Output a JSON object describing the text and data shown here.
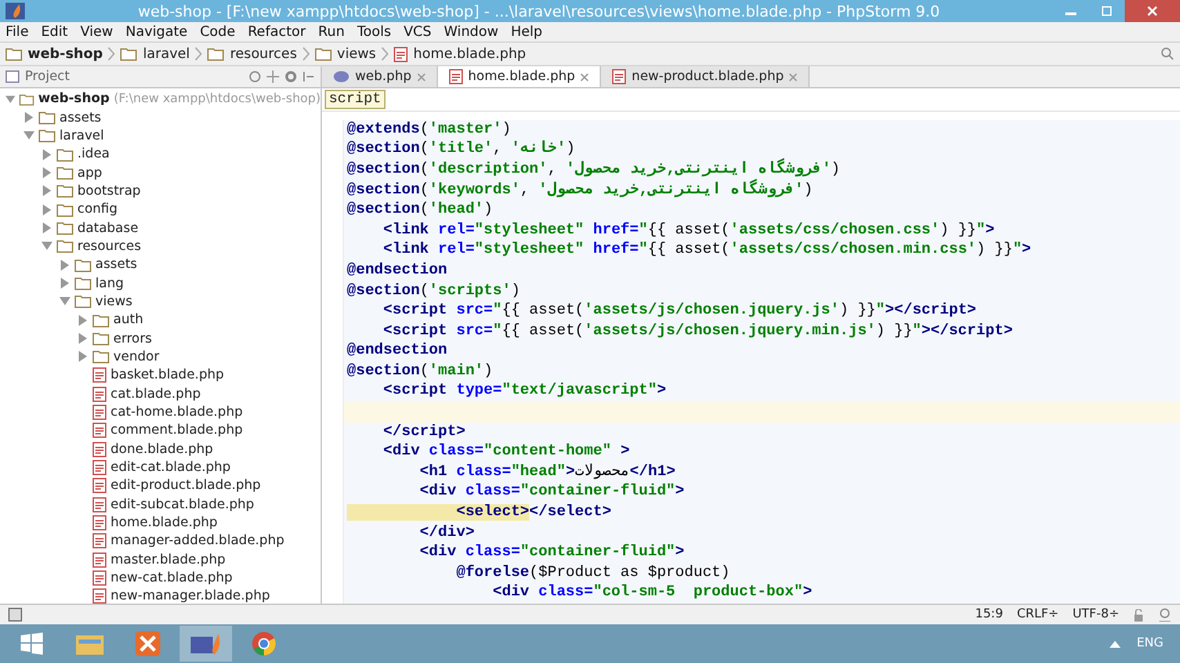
{
  "window": {
    "title": "web-shop - [F:\\new xampp\\htdocs\\web-shop] - ...\\laravel\\resources\\views\\home.blade.php - PhpStorm 9.0"
  },
  "menu": [
    "File",
    "Edit",
    "View",
    "Navigate",
    "Code",
    "Refactor",
    "Run",
    "Tools",
    "VCS",
    "Window",
    "Help"
  ],
  "breadcrumbs": [
    {
      "label": "web-shop",
      "kind": "folder"
    },
    {
      "label": "laravel",
      "kind": "folder"
    },
    {
      "label": "resources",
      "kind": "folder"
    },
    {
      "label": "views",
      "kind": "folder"
    },
    {
      "label": "home.blade.php",
      "kind": "file"
    }
  ],
  "project_panel": {
    "title": "Project",
    "tree": [
      {
        "label": "web-shop",
        "path": "(F:\\new xampp\\htdocs\\web-shop)",
        "kind": "folder",
        "expanded": true,
        "children": [
          {
            "label": "assets",
            "kind": "folder",
            "expanded": false
          },
          {
            "label": "laravel",
            "kind": "folder",
            "expanded": true,
            "children": [
              {
                "label": ".idea",
                "kind": "folder",
                "expanded": false
              },
              {
                "label": "app",
                "kind": "folder",
                "expanded": false
              },
              {
                "label": "bootstrap",
                "kind": "folder",
                "expanded": false
              },
              {
                "label": "config",
                "kind": "folder",
                "expanded": false
              },
              {
                "label": "database",
                "kind": "folder",
                "expanded": false
              },
              {
                "label": "resources",
                "kind": "folder",
                "expanded": true,
                "children": [
                  {
                    "label": "assets",
                    "kind": "folder",
                    "expanded": false
                  },
                  {
                    "label": "lang",
                    "kind": "folder",
                    "expanded": false
                  },
                  {
                    "label": "views",
                    "kind": "folder",
                    "expanded": true,
                    "children": [
                      {
                        "label": "auth",
                        "kind": "folder",
                        "expanded": false
                      },
                      {
                        "label": "errors",
                        "kind": "folder",
                        "expanded": false
                      },
                      {
                        "label": "vendor",
                        "kind": "folder",
                        "expanded": false
                      },
                      {
                        "label": "basket.blade.php",
                        "kind": "file"
                      },
                      {
                        "label": "cat.blade.php",
                        "kind": "file"
                      },
                      {
                        "label": "cat-home.blade.php",
                        "kind": "file"
                      },
                      {
                        "label": "comment.blade.php",
                        "kind": "file"
                      },
                      {
                        "label": "done.blade.php",
                        "kind": "file"
                      },
                      {
                        "label": "edit-cat.blade.php",
                        "kind": "file"
                      },
                      {
                        "label": "edit-product.blade.php",
                        "kind": "file"
                      },
                      {
                        "label": "edit-subcat.blade.php",
                        "kind": "file"
                      },
                      {
                        "label": "home.blade.php",
                        "kind": "file"
                      },
                      {
                        "label": "manager-added.blade.php",
                        "kind": "file"
                      },
                      {
                        "label": "master.blade.php",
                        "kind": "file"
                      },
                      {
                        "label": "new-cat.blade.php",
                        "kind": "file"
                      },
                      {
                        "label": "new-manager.blade.php",
                        "kind": "file"
                      }
                    ]
                  }
                ]
              }
            ]
          }
        ]
      }
    ]
  },
  "tabs": [
    {
      "label": "web.php",
      "kind": "php",
      "selected": false
    },
    {
      "label": "home.blade.php",
      "kind": "blade",
      "selected": true
    },
    {
      "label": "new-product.blade.php",
      "kind": "blade",
      "selected": false
    }
  ],
  "editor": {
    "context": "script",
    "lines": [
      {
        "current": false,
        "segments": [
          {
            "text": "@extends",
            "kind": "directive"
          },
          {
            "text": "(",
            "kind": "plain"
          },
          {
            "text": "'master'",
            "kind": "string"
          },
          {
            "text": ")",
            "kind": "plain"
          }
        ]
      },
      {
        "current": false,
        "segments": [
          {
            "text": "@section",
            "kind": "directive"
          },
          {
            "text": "(",
            "kind": "plain"
          },
          {
            "text": "'title'",
            "kind": "string"
          },
          {
            "text": ", ",
            "kind": "plain"
          },
          {
            "text": "'خانه'",
            "kind": "string"
          },
          {
            "text": ")",
            "kind": "plain"
          }
        ]
      },
      {
        "current": false,
        "segments": [
          {
            "text": "@section",
            "kind": "directive"
          },
          {
            "text": "(",
            "kind": "plain"
          },
          {
            "text": "'description'",
            "kind": "string"
          },
          {
            "text": ", ",
            "kind": "plain"
          },
          {
            "text": "'فروشگاه اینترنتی,خرید محصول'",
            "kind": "string"
          },
          {
            "text": ")",
            "kind": "plain"
          }
        ]
      },
      {
        "current": false,
        "segments": [
          {
            "text": "@section",
            "kind": "directive"
          },
          {
            "text": "(",
            "kind": "plain"
          },
          {
            "text": "'keywords'",
            "kind": "string"
          },
          {
            "text": ", ",
            "kind": "plain"
          },
          {
            "text": "'فروشگاه اینترنتی,خرید محصول'",
            "kind": "string"
          },
          {
            "text": ")",
            "kind": "plain"
          }
        ]
      },
      {
        "current": false,
        "segments": [
          {
            "text": "@section",
            "kind": "directive"
          },
          {
            "text": "(",
            "kind": "plain"
          },
          {
            "text": "'head'",
            "kind": "string"
          },
          {
            "text": ")",
            "kind": "plain"
          }
        ]
      },
      {
        "current": false,
        "segments": [
          {
            "text": "    <link ",
            "kind": "tag"
          },
          {
            "text": "rel=",
            "kind": "attr"
          },
          {
            "text": "\"stylesheet\" ",
            "kind": "string"
          },
          {
            "text": "href=",
            "kind": "attr"
          },
          {
            "text": "\"",
            "kind": "string"
          },
          {
            "text": "{{ asset(",
            "kind": "plain"
          },
          {
            "text": "'assets/css/chosen.css'",
            "kind": "string"
          },
          {
            "text": ") }}",
            "kind": "plain"
          },
          {
            "text": "\"",
            "kind": "string"
          },
          {
            "text": ">",
            "kind": "tag"
          }
        ]
      },
      {
        "current": false,
        "segments": [
          {
            "text": "    <link ",
            "kind": "tag"
          },
          {
            "text": "rel=",
            "kind": "attr"
          },
          {
            "text": "\"stylesheet\" ",
            "kind": "string"
          },
          {
            "text": "href=",
            "kind": "attr"
          },
          {
            "text": "\"",
            "kind": "string"
          },
          {
            "text": "{{ asset(",
            "kind": "plain"
          },
          {
            "text": "'assets/css/chosen.min.css'",
            "kind": "string"
          },
          {
            "text": ") }}",
            "kind": "plain"
          },
          {
            "text": "\"",
            "kind": "string"
          },
          {
            "text": ">",
            "kind": "tag"
          }
        ]
      },
      {
        "current": false,
        "segments": [
          {
            "text": "@endsection",
            "kind": "directive"
          }
        ]
      },
      {
        "current": false,
        "segments": [
          {
            "text": "@section",
            "kind": "directive"
          },
          {
            "text": "(",
            "kind": "plain"
          },
          {
            "text": "'scripts'",
            "kind": "string"
          },
          {
            "text": ")",
            "kind": "plain"
          }
        ]
      },
      {
        "current": false,
        "segments": [
          {
            "text": "    <script ",
            "kind": "tag"
          },
          {
            "text": "src=",
            "kind": "attr"
          },
          {
            "text": "\"",
            "kind": "string"
          },
          {
            "text": "{{ asset(",
            "kind": "plain"
          },
          {
            "text": "'assets/js/chosen.jquery.js'",
            "kind": "string"
          },
          {
            "text": ") }}",
            "kind": "plain"
          },
          {
            "text": "\"",
            "kind": "string"
          },
          {
            "text": "></script>",
            "kind": "tag"
          }
        ]
      },
      {
        "current": false,
        "segments": [
          {
            "text": "    <script ",
            "kind": "tag"
          },
          {
            "text": "src=",
            "kind": "attr"
          },
          {
            "text": "\"",
            "kind": "string"
          },
          {
            "text": "{{ asset(",
            "kind": "plain"
          },
          {
            "text": "'assets/js/chosen.jquery.min.js'",
            "kind": "string"
          },
          {
            "text": ") }}",
            "kind": "plain"
          },
          {
            "text": "\"",
            "kind": "string"
          },
          {
            "text": "></script>",
            "kind": "tag"
          }
        ]
      },
      {
        "current": false,
        "segments": [
          {
            "text": "@endsection",
            "kind": "directive"
          }
        ]
      },
      {
        "current": false,
        "segments": [
          {
            "text": "@section",
            "kind": "directive"
          },
          {
            "text": "(",
            "kind": "plain"
          },
          {
            "text": "'main'",
            "kind": "string"
          },
          {
            "text": ")",
            "kind": "plain"
          }
        ]
      },
      {
        "current": false,
        "segments": [
          {
            "text": "    <script ",
            "kind": "tag"
          },
          {
            "text": "type=",
            "kind": "attr"
          },
          {
            "text": "\"text/javascript\"",
            "kind": "string"
          },
          {
            "text": ">",
            "kind": "tag"
          }
        ]
      },
      {
        "current": true
      },
      {
        "current": false,
        "segments": [
          {
            "text": "    </script>",
            "kind": "tag"
          }
        ]
      },
      {
        "current": false,
        "segments": [
          {
            "text": "    <div ",
            "kind": "tag"
          },
          {
            "text": "class=",
            "kind": "attr"
          },
          {
            "text": "\"content-home\" ",
            "kind": "string"
          },
          {
            "text": ">",
            "kind": "tag"
          }
        ]
      },
      {
        "current": false,
        "segments": [
          {
            "text": "        <h1 ",
            "kind": "tag"
          },
          {
            "text": "class=",
            "kind": "attr"
          },
          {
            "text": "\"head\"",
            "kind": "string"
          },
          {
            "text": ">",
            "kind": "tag"
          },
          {
            "text": "محصولات",
            "kind": "plain"
          },
          {
            "text": "</h1>",
            "kind": "tag"
          }
        ]
      },
      {
        "current": false,
        "segments": [
          {
            "text": "        <div ",
            "kind": "tag"
          },
          {
            "text": "class=",
            "kind": "attr"
          },
          {
            "text": "\"container-fluid\"",
            "kind": "string"
          },
          {
            "text": ">",
            "kind": "tag"
          }
        ]
      },
      {
        "current": false,
        "segments": [
          {
            "text": "            <select>",
            "kind": "match"
          },
          {
            "text": "</select>",
            "kind": "tag"
          }
        ]
      },
      {
        "current": false,
        "segments": [
          {
            "text": "        </div>",
            "kind": "tag"
          }
        ]
      },
      {
        "current": false,
        "segments": [
          {
            "text": "        <div ",
            "kind": "tag"
          },
          {
            "text": "class=",
            "kind": "attr"
          },
          {
            "text": "\"container-fluid\"",
            "kind": "string"
          },
          {
            "text": ">",
            "kind": "tag"
          }
        ]
      },
      {
        "current": false,
        "segments": [
          {
            "text": "            @forelse",
            "kind": "directive"
          },
          {
            "text": "($Product as $product)",
            "kind": "plain"
          }
        ]
      },
      {
        "current": false,
        "segments": [
          {
            "text": "                <div ",
            "kind": "tag"
          },
          {
            "text": "class=",
            "kind": "attr"
          },
          {
            "text": "\"col-sm-5  product-box\"",
            "kind": "string"
          },
          {
            "text": ">",
            "kind": "tag"
          }
        ]
      }
    ]
  },
  "status_bar": {
    "position": "15:9",
    "line_separator": "CRLF÷",
    "encoding": "UTF-8÷"
  },
  "taskbar": {
    "language": "ENG"
  }
}
